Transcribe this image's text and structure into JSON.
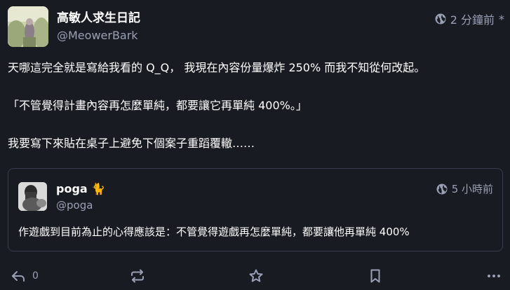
{
  "author": {
    "display_name": "高敏人求生日記",
    "handle": "@MeowerBark"
  },
  "timestamp": {
    "relative": "2 分鐘前",
    "edited_mark": "*"
  },
  "post": {
    "paragraphs": [
      "天哪這完全就是寫給我看的 Q_Q， 我現在內容份量爆炸 250% 而我不知從何改起。",
      "「不管覺得計畫內容再怎麼單純，都要讓它再單純 400%。」",
      "我要寫下來貼在桌子上避免下個案子重蹈覆轍……"
    ]
  },
  "quoted_post": {
    "display_name": "poga",
    "emoji": "🐈",
    "handle": "@poga",
    "relative_time": "5 小時前",
    "text": "作遊戲到目前為止的心得應該是：不管覺得遊戲再怎麼單純，都要讓他再單純 400%"
  },
  "actions": {
    "reply_count": "0",
    "icons": [
      "reply-icon",
      "boost-icon",
      "favourite-icon",
      "bookmark-icon",
      "more-icon"
    ]
  }
}
